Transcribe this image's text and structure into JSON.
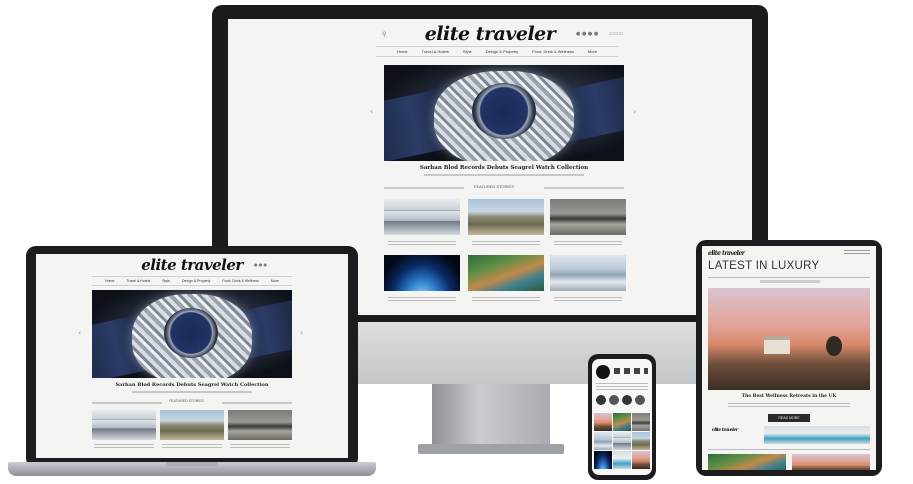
{
  "site": {
    "logo_text": "elite traveler",
    "tablet_logo_text": "elite traveler",
    "nav": [
      "Home",
      "Travel & Hotels",
      "Style",
      "Design & Property",
      "Food, Drink & Wellness",
      "More"
    ],
    "hero_caption": "Sarhan Blod Records Debuts Seagrel Watch Collection",
    "section_label": "FEATURED STORIES",
    "tablet_headline": "LATEST IN LUXURY",
    "tablet_caption": "The Best Wellness Retreats in the UK",
    "tablet_button": "READ MORE"
  },
  "colors": {
    "device_dark": "#1c1c1e",
    "screen_bg": "#f4f4f2",
    "stand": "#b9bcbf"
  }
}
